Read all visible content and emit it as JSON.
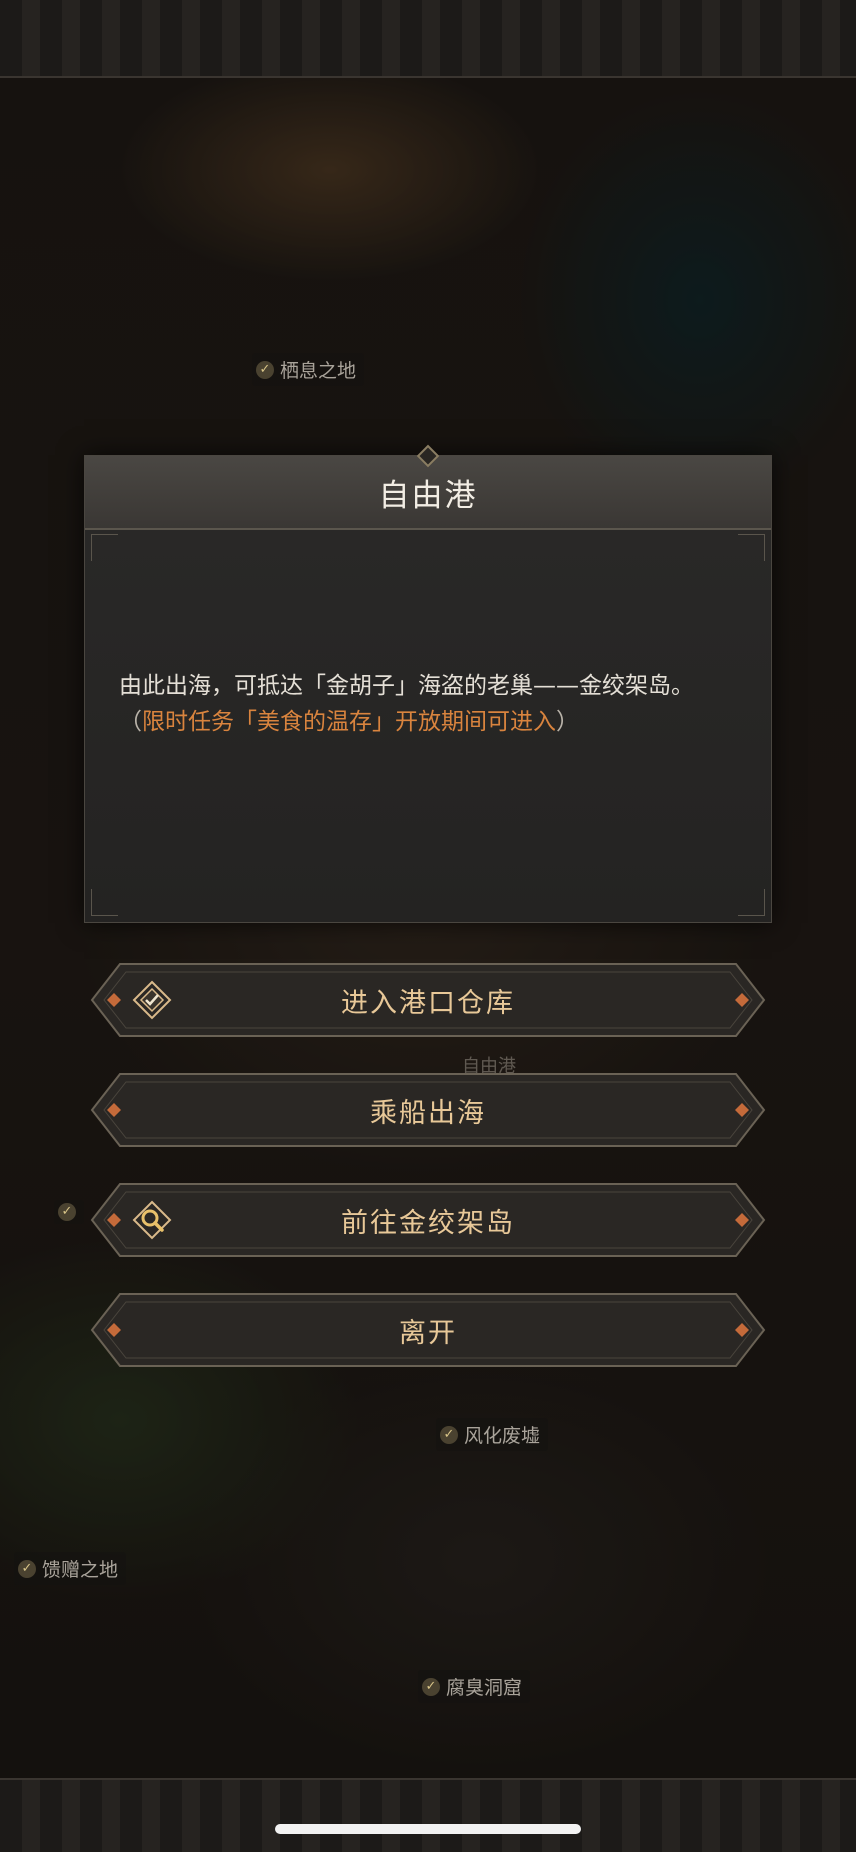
{
  "map": {
    "locations": [
      {
        "name": "栖息之地"
      },
      {
        "name": "自由港"
      },
      {
        "name": "风化废墟"
      },
      {
        "name": "馈赠之地"
      },
      {
        "name": "腐臭洞窟"
      }
    ]
  },
  "dialog": {
    "title": "自由港",
    "description": "由此出海，可抵达「金胡子」海盗的老巢——金绞架岛。",
    "note_open": "（",
    "note": "限时任务「美食的温存」开放期间可进入",
    "note_close": "）"
  },
  "actions": [
    {
      "label": "进入港口仓库",
      "icon": "checkmark-diamond-icon"
    },
    {
      "label": "乘船出海",
      "icon": ""
    },
    {
      "label": "前往金绞架岛",
      "icon": "magnifier-icon"
    },
    {
      "label": "离开",
      "icon": ""
    }
  ],
  "colors": {
    "accent_orange": "#d9843e",
    "button_text": "#e8c898",
    "title_text": "#f2ede4"
  }
}
